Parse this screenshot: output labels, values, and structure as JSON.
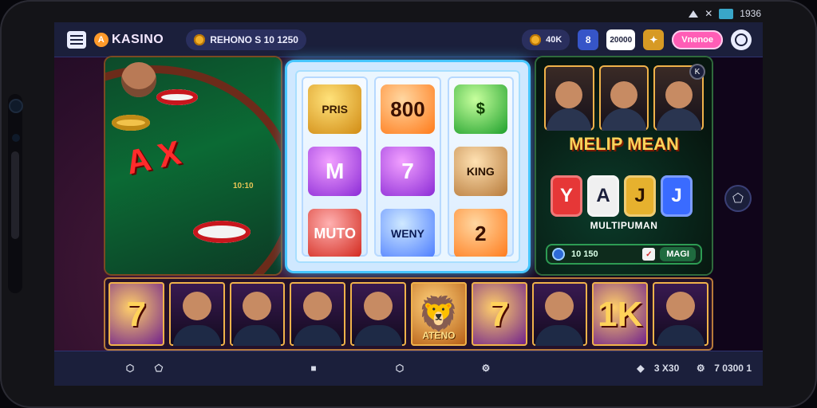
{
  "status_bar": {
    "time": "1936"
  },
  "top_bar": {
    "app_name": "KASINO",
    "app_mark": "A",
    "balance_text": "REHONO S 10 1250",
    "chips_text": "40K",
    "user_badge": "8",
    "voucher_text": "20000",
    "cta_text": "Vnenoe",
    "icons": {
      "menu": "menu-icon",
      "coin": "coin-icon",
      "profile": "profile-icon",
      "user": "user-icon",
      "voucher": "ticket-icon",
      "bonus": "bonus-icon"
    }
  },
  "panels": {
    "roulette": {
      "big_text": "A X",
      "sub_text": "10:10"
    },
    "slots": {
      "reels": [
        [
          "PRIS",
          "M",
          "MUTO"
        ],
        [
          "800",
          "7",
          "WENY"
        ],
        [
          "$",
          "KING",
          "2"
        ]
      ]
    },
    "multiplayer": {
      "close_text": "K",
      "title": "MELIP MEAN",
      "dice": [
        "Y",
        "A",
        "J",
        "J"
      ],
      "subtitle": "MULTIPUMAN",
      "bottom_left": "10 150",
      "bottom_right": "MAGI",
      "check": "✓"
    }
  },
  "carousel": {
    "tiles": [
      {
        "type": "num",
        "text": "7"
      },
      {
        "type": "photo",
        "text": ""
      },
      {
        "type": "photo",
        "text": ""
      },
      {
        "type": "photo",
        "text": ""
      },
      {
        "type": "photo",
        "text": ""
      },
      {
        "type": "lion",
        "text": "ATENO"
      },
      {
        "type": "num",
        "text": "7"
      },
      {
        "type": "photo",
        "text": ""
      },
      {
        "type": "num",
        "text": "1K"
      },
      {
        "type": "photo",
        "text": ""
      }
    ]
  },
  "bottom_nav": {
    "left_items": [
      {
        "name": "home",
        "icon": "home-icon"
      },
      {
        "name": "chat",
        "icon": "chat-icon"
      }
    ],
    "center_items": [
      {
        "name": "nav-slot-1",
        "icon": "square-icon"
      },
      {
        "name": "nav-slot-2",
        "icon": "shield-icon"
      },
      {
        "name": "nav-slot-3",
        "icon": "settings-icon"
      }
    ],
    "right_items": [
      {
        "name": "score",
        "icon": "dice-icon",
        "text": "3 X30"
      },
      {
        "name": "coins",
        "icon": "gear-icon",
        "text": "7 0300 1"
      }
    ]
  },
  "colors": {
    "accent": "#47c6ff",
    "pink": "#ff5db6",
    "gold": "#f2b02a",
    "nav": "#1b1f3b"
  }
}
